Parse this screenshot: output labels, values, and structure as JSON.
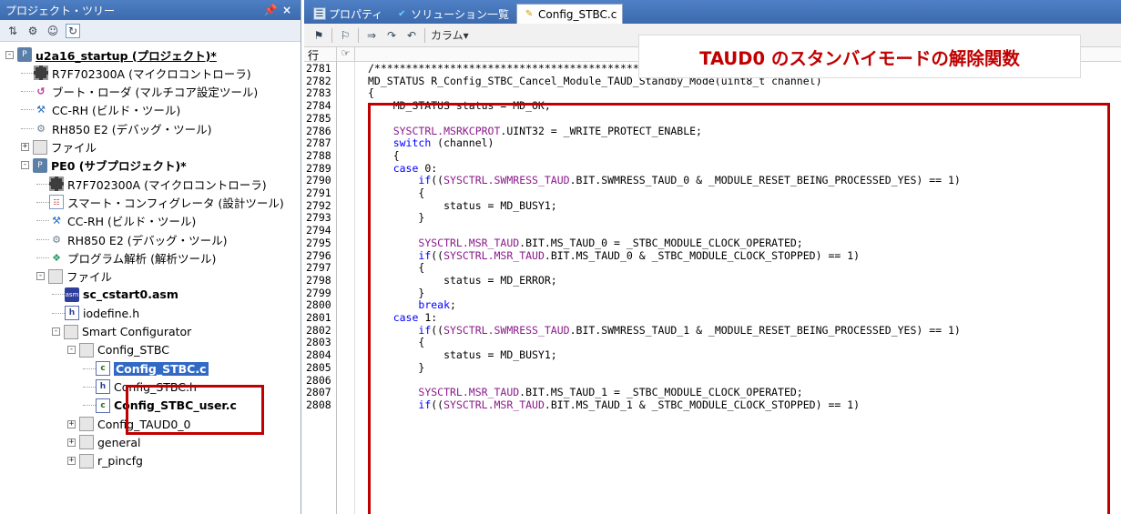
{
  "tree_panel": {
    "title": "プロジェクト・ツリー",
    "pin_label": "♂",
    "close_label": "×",
    "items": [
      {
        "label": "u2a16_startup (プロジェクト)*",
        "icon": "project-icon"
      },
      {
        "label": "R7F702300A (マイクロコントローラ)",
        "icon": "chip-icon"
      },
      {
        "label": "ブート・ローダ (マルチコア設定ツール)",
        "icon": "bootloader-icon"
      },
      {
        "label": "CC-RH (ビルド・ツール)",
        "icon": "build-tool-icon"
      },
      {
        "label": "RH850 E2 (デバッグ・ツール)",
        "icon": "debug-tool-icon"
      },
      {
        "label": "ファイル",
        "icon": "folder-icon"
      },
      {
        "label": "PE0 (サブプロジェクト)*",
        "icon": "subproject-icon"
      },
      {
        "label": "R7F702300A (マイクロコントローラ)",
        "icon": "chip-icon"
      },
      {
        "label": "スマート・コンフィグレータ (設計ツール)",
        "icon": "smart-configurator-icon"
      },
      {
        "label": "CC-RH (ビルド・ツール)",
        "icon": "build-tool-icon"
      },
      {
        "label": "RH850 E2 (デバッグ・ツール)",
        "icon": "debug-tool-icon"
      },
      {
        "label": "プログラム解析 (解析ツール)",
        "icon": "analysis-tool-icon"
      },
      {
        "label": "ファイル",
        "icon": "folder-icon"
      },
      {
        "label": "sc_cstart0.asm",
        "icon": "asm-file-icon"
      },
      {
        "label": "iodefine.h",
        "icon": "header-file-icon"
      },
      {
        "label": "Smart Configurator",
        "icon": "folder-icon"
      },
      {
        "label": "Config_STBC",
        "icon": "folder-icon"
      },
      {
        "label": "Config_STBC.c",
        "icon": "c-file-icon"
      },
      {
        "label": "Config_STBC.h",
        "icon": "header-file-icon"
      },
      {
        "label": "Config_STBC_user.c",
        "icon": "c-file-icon"
      },
      {
        "label": "Config_TAUD0_0",
        "icon": "folder-icon"
      },
      {
        "label": "general",
        "icon": "folder-icon"
      },
      {
        "label": "r_pincfg",
        "icon": "folder-icon"
      }
    ]
  },
  "tabs": [
    {
      "label": "プロパティ",
      "icon": "properties-icon"
    },
    {
      "label": "ソリューション一覧",
      "icon": "solution-icon"
    },
    {
      "label": "Config_STBC.c",
      "icon": "c-file-icon"
    }
  ],
  "editor_toolbar": {
    "column_label": "カラム▾"
  },
  "editor_header": {
    "line_col": "行",
    "mark_col": "☞"
  },
  "callout": "TAUD0 のスタンバイモードの解除関数",
  "colors": {
    "highlight": "#c00000",
    "panel_title": "#3b6aae",
    "keyword": "#0000ff",
    "macro": "#7a0000",
    "register": "#8b1a8b"
  },
  "code_lines": [
    {
      "n": "2781",
      "text": "/*******************************************************************************************************"
    },
    {
      "n": "2782",
      "text": "MD_STATUS R_Config_STBC_Cancel_Module_TAUD_Standby_Mode(uint8_t channel)"
    },
    {
      "n": "2783",
      "text": "{"
    },
    {
      "n": "2784",
      "text": "    MD_STATUS status = MD_OK;"
    },
    {
      "n": "2785",
      "text": ""
    },
    {
      "n": "2786",
      "text": "    SYSCTRL.MSRKCPROT.UINT32 = _WRITE_PROTECT_ENABLE;"
    },
    {
      "n": "2787",
      "text": "    switch (channel)"
    },
    {
      "n": "2788",
      "text": "    {"
    },
    {
      "n": "2789",
      "text": "    case 0:"
    },
    {
      "n": "2790",
      "text": "        if((SYSCTRL.SWMRESS_TAUD.BIT.SWMRESS_TAUD_0 & _MODULE_RESET_BEING_PROCESSED_YES) == 1)"
    },
    {
      "n": "2791",
      "text": "        {"
    },
    {
      "n": "2792",
      "text": "            status = MD_BUSY1;"
    },
    {
      "n": "2793",
      "text": "        }"
    },
    {
      "n": "2794",
      "text": ""
    },
    {
      "n": "2795",
      "text": "        SYSCTRL.MSR_TAUD.BIT.MS_TAUD_0 = _STBC_MODULE_CLOCK_OPERATED;"
    },
    {
      "n": "2796",
      "text": "        if((SYSCTRL.MSR_TAUD.BIT.MS_TAUD_0 & _STBC_MODULE_CLOCK_STOPPED) == 1)"
    },
    {
      "n": "2797",
      "text": "        {"
    },
    {
      "n": "2798",
      "text": "            status = MD_ERROR;"
    },
    {
      "n": "2799",
      "text": "        }"
    },
    {
      "n": "2800",
      "text": "        break;"
    },
    {
      "n": "2801",
      "text": "    case 1:"
    },
    {
      "n": "2802",
      "text": "        if((SYSCTRL.SWMRESS_TAUD.BIT.SWMRESS_TAUD_1 & _MODULE_RESET_BEING_PROCESSED_YES) == 1)"
    },
    {
      "n": "2803",
      "text": "        {"
    },
    {
      "n": "2804",
      "text": "            status = MD_BUSY1;"
    },
    {
      "n": "2805",
      "text": "        }"
    },
    {
      "n": "2806",
      "text": ""
    },
    {
      "n": "2807",
      "text": "        SYSCTRL.MSR_TAUD.BIT.MS_TAUD_1 = _STBC_MODULE_CLOCK_OPERATED;"
    },
    {
      "n": "2808",
      "text": "        if((SYSCTRL.MSR_TAUD.BIT.MS_TAUD_1 & _STBC_MODULE_CLOCK_STOPPED) == 1)"
    }
  ]
}
